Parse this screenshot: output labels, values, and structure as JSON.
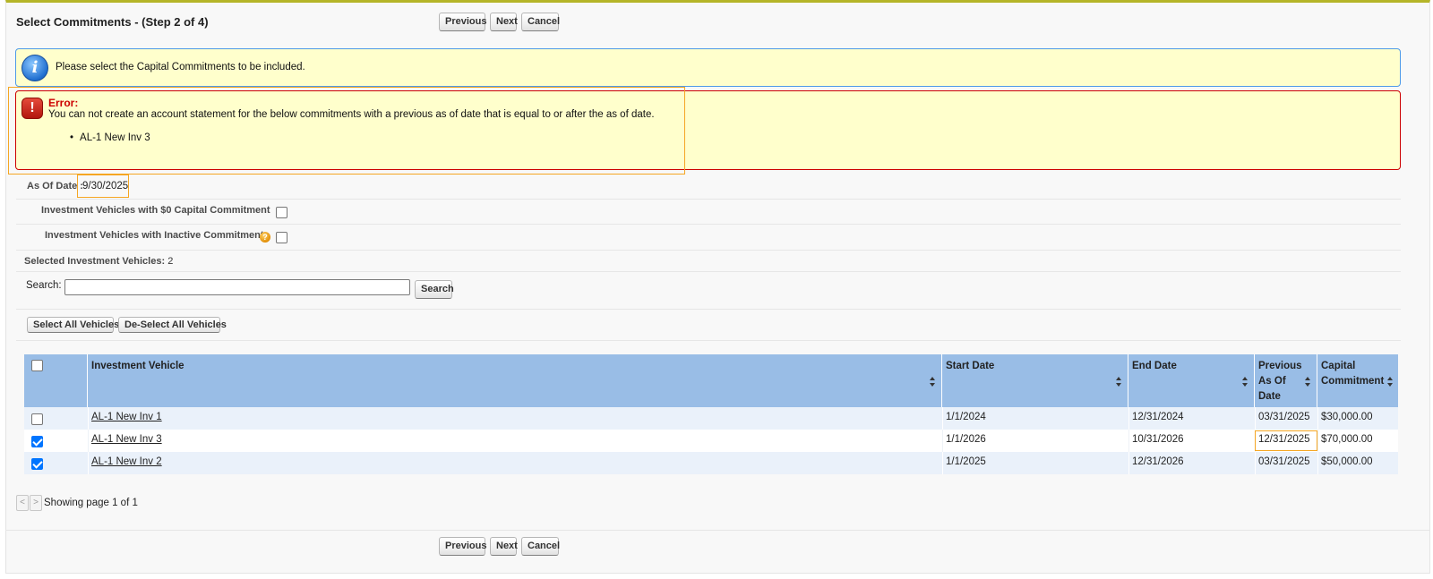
{
  "header": {
    "title": "Select Commitments - (Step 2 of 4)",
    "buttons": {
      "previous": "Previous",
      "next": "Next",
      "cancel": "Cancel"
    }
  },
  "info_message": {
    "icon": "info-icon",
    "text": "Please select the Capital Commitments to be included."
  },
  "error_message": {
    "icon": "error-icon",
    "title": "Error:",
    "text": "You can not create an account statement for the below commitments with a previous as of date that is equal to or after the as of date.",
    "items": [
      "AL-1 New Inv 3"
    ]
  },
  "form": {
    "as_of_date_label": "As Of Date",
    "as_of_date_value": "9/30/2025",
    "zero_commitment_label": "Investment Vehicles with $0 Capital Commitment",
    "zero_commitment_checked": false,
    "inactive_label": "Investment Vehicles with Inactive Commitments",
    "inactive_checked": false,
    "selected_label": "Selected Investment Vehicles:",
    "selected_count": "2",
    "search_label": "Search:",
    "search_value": "",
    "search_button": "Search",
    "select_all_button": "Select All Vehicles",
    "deselect_all_button": "De-Select All Vehicles"
  },
  "table": {
    "columns": {
      "vehicle": "Investment Vehicle",
      "start": "Start Date",
      "end": "End Date",
      "previous_line1": "Previous",
      "previous_line2": "As Of",
      "previous_line3": "Date",
      "capital_line1": "Capital",
      "capital_line2": "Commitment"
    },
    "rows": [
      {
        "checked": false,
        "vehicle": "AL-1 New Inv 1",
        "start": "1/1/2024",
        "end": "12/31/2024",
        "previous": "03/31/2025",
        "capital": "$30,000.00"
      },
      {
        "checked": true,
        "vehicle": "AL-1 New Inv 3",
        "start": "1/1/2026",
        "end": "10/31/2026",
        "previous": "12/31/2025",
        "capital": "$70,000.00"
      },
      {
        "checked": true,
        "vehicle": "AL-1 New Inv 2",
        "start": "1/1/2025",
        "end": "12/31/2026",
        "previous": "03/31/2025",
        "capital": "$50,000.00"
      }
    ]
  },
  "pagination": {
    "prev_symbol": "<",
    "next_symbol": ">",
    "text": "Showing page 1 of 1"
  },
  "colors": {
    "header_accent": "#b5b528",
    "info_bg": "#ffffcc",
    "info_border": "#4f9ae8",
    "error_border": "#cc0000",
    "table_header": "#99bde6",
    "row_alt": "#eaf1fa",
    "focus_outline": "#f5a623"
  }
}
